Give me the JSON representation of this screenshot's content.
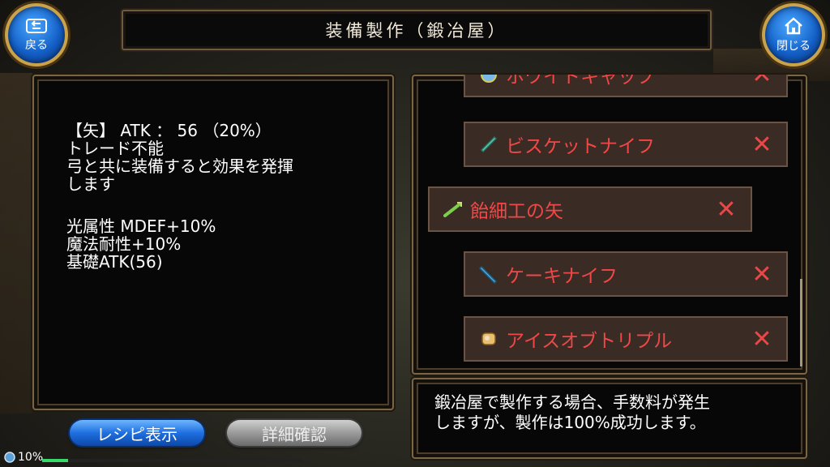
{
  "header": {
    "title": "装備製作（鍛冶屋）"
  },
  "nav": {
    "back_label": "戻る",
    "close_label": "閉じる"
  },
  "description": {
    "lines": [
      "【矢】 ATK ： 56 （20%）",
      "トレード不能",
      "弓と共に装備すると効果を発揮",
      "します",
      "",
      "光属性 MDEF+10%",
      "魔法耐性+10%",
      "基礎ATK(56)"
    ]
  },
  "recipe_list": {
    "items": [
      {
        "name": "ホワイトキャップ",
        "icon": "cap-icon",
        "selected": false,
        "craftable": false,
        "x_mark": "✕"
      },
      {
        "name": "ビスケットナイフ",
        "icon": "knife-icon",
        "selected": false,
        "craftable": false,
        "x_mark": "✕"
      },
      {
        "name": "飴細工の矢",
        "icon": "arrow-icon",
        "selected": true,
        "craftable": false,
        "x_mark": "✕"
      },
      {
        "name": "ケーキナイフ",
        "icon": "knife-icon",
        "selected": false,
        "craftable": false,
        "x_mark": "✕"
      },
      {
        "name": "アイスオブトリプル",
        "icon": "ice-icon",
        "selected": false,
        "craftable": false,
        "x_mark": "✕"
      }
    ]
  },
  "notice": {
    "line1": "鍛冶屋で製作する場合、手数料が発生",
    "line2": "しますが、製作は100%成功します。"
  },
  "buttons": {
    "recipe_label": "レシピ表示",
    "detail_label": "詳細確認"
  },
  "status": {
    "progress_label": "10%",
    "progress_value": 0.1
  },
  "colors": {
    "item_name": "#f04848",
    "accent_blue": "#1f6fe0",
    "frame_gold": "#c9a24a"
  }
}
